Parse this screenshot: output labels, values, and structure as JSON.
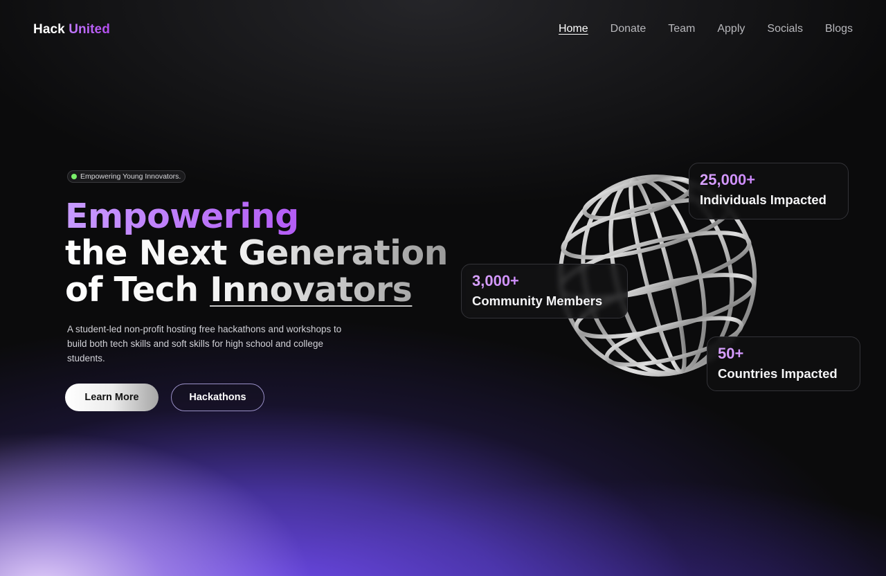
{
  "brand": {
    "part1": "Hack",
    "part2": "United"
  },
  "nav": {
    "items": [
      {
        "label": "Home",
        "active": true
      },
      {
        "label": "Donate",
        "active": false
      },
      {
        "label": "Team",
        "active": false
      },
      {
        "label": "Apply",
        "active": false
      },
      {
        "label": "Socials",
        "active": false
      },
      {
        "label": "Blogs",
        "active": false
      }
    ]
  },
  "hero": {
    "badge": "Empowering Young Innovators.",
    "headline_line1": "Empowering",
    "headline_line2": "the Next Generation",
    "headline_line3_a": "of Tech ",
    "headline_line3_b": "Innovators",
    "description": "A student-led non-profit hosting free hackathons and workshops to build both tech skills and soft skills for high school and college students.",
    "primary_button": "Learn More",
    "secondary_button": "Hackathons"
  },
  "stats": [
    {
      "value": "25,000+",
      "label": "Individuals Impacted"
    },
    {
      "value": "3,000+",
      "label": "Community Members"
    },
    {
      "value": "50+",
      "label": "Countries Impacted"
    }
  ],
  "colors": {
    "accent_purple": "#b45df5",
    "background": "#0b0b0c",
    "glow_purple": "#7850ff",
    "badge_dot": "#7af06a"
  },
  "icons": {
    "badge_dot": "status-dot-icon",
    "hero_graphic": "wireframe-globe-icon"
  }
}
